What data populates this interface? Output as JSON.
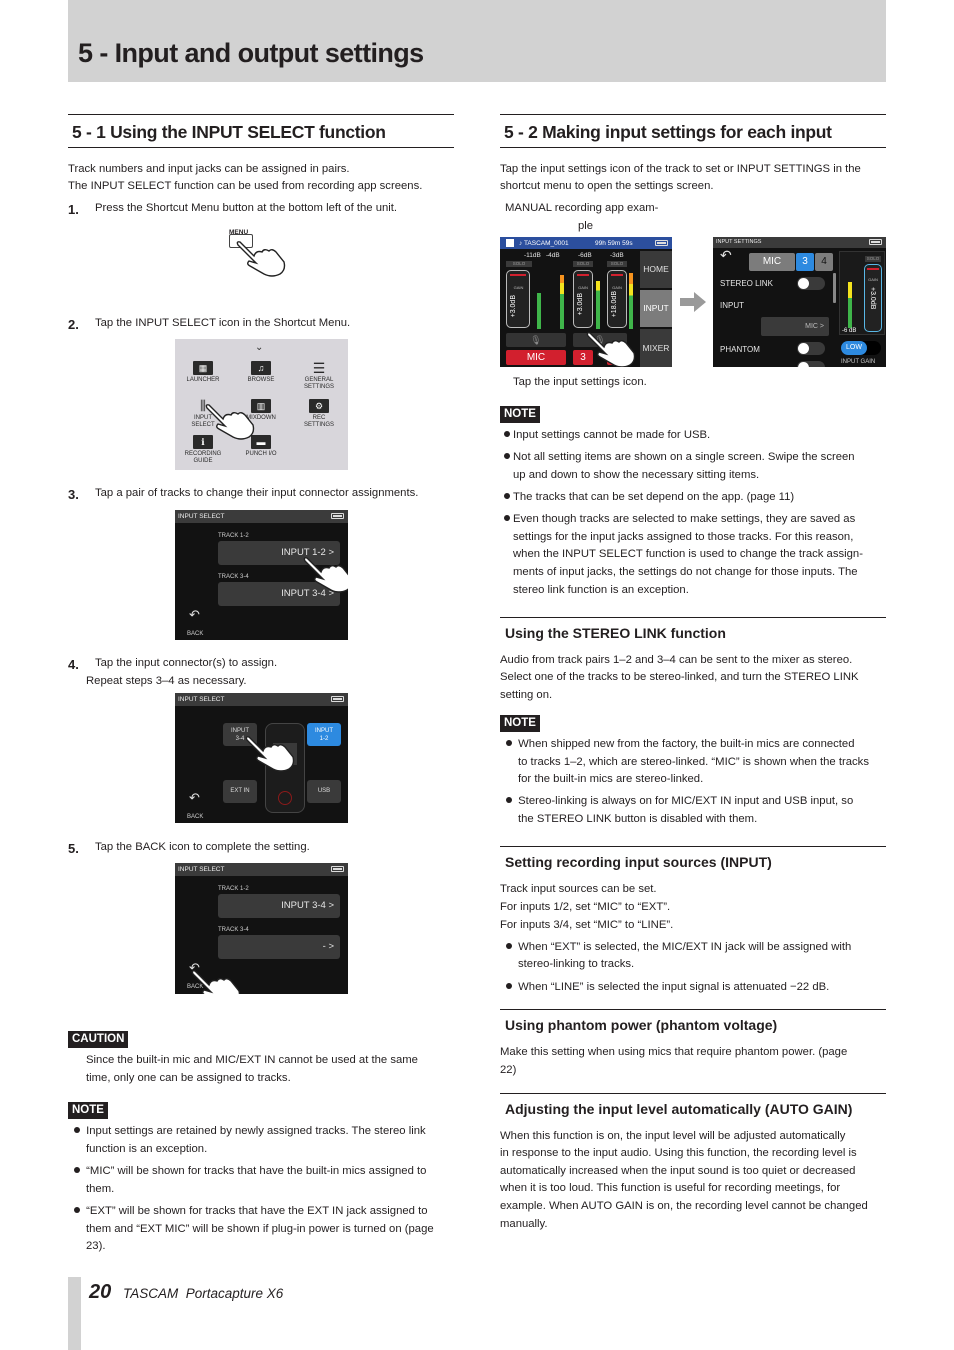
{
  "chapter": {
    "title": "5 - Input and output settings"
  },
  "left": {
    "section_title": "5 - 1 Using the INPUT SELECT function",
    "intro": [
      "Track numbers and input jacks can be assigned in pairs.",
      "The INPUT SELECT function can be used from recording app screens."
    ],
    "steps": [
      {
        "num": "1.",
        "text": "Press the Shortcut Menu button at the bottom left of the unit."
      },
      {
        "num": "2.",
        "text": "Tap the INPUT SELECT icon in the Shortcut Menu."
      },
      {
        "num": "3.",
        "text": "Tap a pair of tracks to change their input connector assignments."
      },
      {
        "num": "4.",
        "text": "Tap the input connector(s) to assign.",
        "sub": "Repeat steps 3–4 as necessary."
      },
      {
        "num": "5.",
        "text": "Tap the BACK icon to complete the setting."
      }
    ],
    "menu_button_label": "MENU",
    "shortcut_menu": {
      "items": [
        {
          "label": "LAUNCHER",
          "icon": "launcher-grid-icon",
          "glyph": "▦"
        },
        {
          "label": "BROWSE",
          "icon": "music-note-icon",
          "glyph": "♫"
        },
        {
          "label": "GENERAL\nSETTINGS",
          "icon": "list-icon",
          "glyph": "☰"
        },
        {
          "label": "INPUT\nSELECT",
          "icon": "input-select-icon",
          "glyph": "⫼"
        },
        {
          "label": "MIXDOWN",
          "icon": "mixdown-icon",
          "glyph": "▥"
        },
        {
          "label": "REC\nSETTINGS",
          "icon": "rec-settings-icon",
          "glyph": "⚙"
        },
        {
          "label": "RECORDING\nGUIDE",
          "icon": "info-icon",
          "glyph": "ℹ"
        },
        {
          "label": "PUNCH I/O",
          "icon": "punch-io-icon",
          "glyph": "▬"
        }
      ]
    },
    "screen_step3": {
      "title": "INPUT SELECT",
      "tracks": [
        {
          "label": "TRACK 1-2",
          "value": "INPUT 1-2 >"
        },
        {
          "label": "TRACK 3-4",
          "value": "INPUT 3-4 >"
        }
      ],
      "back": "BACK"
    },
    "screen_step4": {
      "title": "INPUT SELECT",
      "buttons": {
        "input34": "INPUT\n3-4",
        "input12": "INPUT\n1-2",
        "extin": "EXT IN",
        "usb": "USB"
      },
      "back": "BACK"
    },
    "screen_step5": {
      "title": "INPUT SELECT",
      "tracks": [
        {
          "label": "TRACK 1-2",
          "value": "INPUT 3-4 >"
        },
        {
          "label": "TRACK 3-4",
          "value": "- >"
        }
      ],
      "back": "BACK"
    },
    "caution": {
      "badge": "CAUTION",
      "lines": [
        "Since the built-in mic and MIC/EXT IN cannot be used at the same",
        "time, only one can be assigned to tracks."
      ]
    },
    "note": {
      "badge": "NOTE",
      "bullets": [
        [
          "Input settings are retained by newly assigned tracks. The stereo link",
          "function is an exception."
        ],
        [
          "“MIC” will be shown for tracks that have the built-in mics assigned to",
          "them."
        ],
        [
          "“EXT” will be shown for tracks that have the EXT IN jack assigned to",
          "them and “EXT MIC” will be shown if plug-in power is turned on (page",
          "23)."
        ]
      ]
    }
  },
  "right": {
    "section_title": "5 - 2 Making input settings for each input",
    "intro": [
      "Tap the input settings icon of the track to set or INPUT SETTINGS in the",
      "shortcut menu to open the settings screen."
    ],
    "example_caption": [
      "MANUAL recording app exam-",
      "ple"
    ],
    "tap_caption": "Tap the input settings icon.",
    "rec_screen": {
      "filename": "♪ TASCAM_0001",
      "remaining": "99h 59m 59s",
      "levels": [
        "-11dB",
        "-4dB",
        "-6dB",
        "-3dB"
      ],
      "solo": "SOLO",
      "gain_label": "GAIN",
      "gains": [
        "+3.0dB",
        "+3.0dB",
        "+18.0dB"
      ],
      "side_buttons": [
        "HOME",
        "INPUT",
        "MIXER"
      ],
      "inputs": [
        "MIC",
        "3"
      ]
    },
    "settings_screen": {
      "title": "INPUT SETTINGS",
      "tabs": [
        "MIC",
        "3",
        "4"
      ],
      "rows": [
        "STEREO LINK",
        "INPUT",
        "PHANTOM"
      ],
      "input_value": "MIC >",
      "solo": "SOLO",
      "gain_label": "GAIN",
      "gain_value": "+3.0dB",
      "level": "-6 dB",
      "input_gain_toggle": "LOW",
      "input_gain_label": "INPUT GAIN"
    },
    "note1": {
      "badge": "NOTE",
      "bullets": [
        [
          "Input settings cannot be made for USB."
        ],
        [
          "Not all setting items are shown on a single screen. Swipe the screen",
          "up and down to show the necessary sitting items."
        ],
        [
          "The tracks that can be set depend on the app. (page 11)"
        ],
        [
          "Even though tracks are selected to make settings, they are saved as",
          "settings for the input jacks assigned to those tracks. For this reason,",
          "when the INPUT SELECT function is used to change the track assign-",
          "ments of input jacks, the settings do not change for those inputs. The",
          "stereo link function is an exception."
        ]
      ]
    },
    "stereo_link": {
      "title": "Using the STEREO LINK function",
      "body": [
        "Audio from track pairs 1–2 and 3–4 can be sent to the mixer as stereo.",
        "Select one of the tracks to be stereo-linked, and turn the STEREO LINK",
        "setting on."
      ],
      "note_badge": "NOTE",
      "bullets": [
        [
          "When shipped new from the factory, the built-in mics are connected",
          "to tracks 1–2, which are stereo-linked. “MIC” is shown when the tracks",
          "for the built-in mics are stereo-linked."
        ],
        [
          "Stereo-linking is always on for MIC/EXT IN input and USB input, so",
          "the STEREO LINK button is disabled with them."
        ]
      ]
    },
    "input_sources": {
      "title": "Setting recording input sources (INPUT)",
      "body": [
        "Track input sources can be set.",
        "For inputs 1/2, set “MIC” to “EXT”.",
        "For inputs 3/4, set “MIC” to “LINE”."
      ],
      "bullets": [
        [
          "When “EXT” is selected, the MIC/EXT IN jack will be assigned with",
          "stereo-linking to tracks."
        ],
        [
          "When “LINE” is selected the input signal is attenuated −22 dB."
        ]
      ]
    },
    "phantom": {
      "title": "Using phantom power (phantom voltage)",
      "body": [
        "Make this setting when using mics that require phantom power. (page",
        "22)"
      ]
    },
    "auto_gain": {
      "title": "Adjusting the input level automatically (AUTO GAIN)",
      "body": [
        "When this function is on, the input level will be adjusted automatically",
        "in response to the input audio. Using this function, the recording level is",
        "automatically increased when the input sound is too quiet or decreased",
        "when it is too loud. This function is useful for recording meetings, for",
        "example. When AUTO GAIN is on, the recording level cannot be changed",
        "manually."
      ]
    }
  },
  "footer": {
    "page": "20",
    "product": "TASCAM  Portacapture X6"
  },
  "colors": {
    "band": "#d2d2d2",
    "accent_red": "#d2202e",
    "accent_blue": "#2d8ae0",
    "rec_bar": "#2c4f9e"
  }
}
